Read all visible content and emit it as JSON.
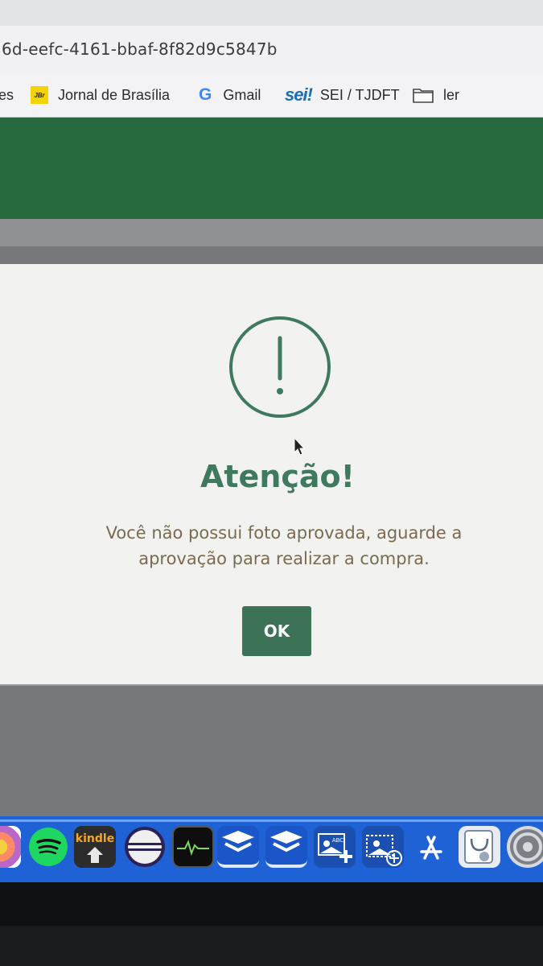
{
  "browser": {
    "url": "6d-eefc-4161-bbaf-8f82d9c5847b",
    "bookmarks": [
      {
        "label": "es",
        "icon": "truncated"
      },
      {
        "label": "Jornal de Brasília",
        "icon": "jbr-icon",
        "icon_text": "JBr"
      },
      {
        "label": "Gmail",
        "icon": "google-icon",
        "icon_text": "G"
      },
      {
        "label": "SEI / TJDFT",
        "icon": "sei-icon",
        "icon_text": "sei!"
      },
      {
        "label": "ler",
        "icon": "folder-icon"
      }
    ]
  },
  "dialog": {
    "icon": "exclamation-circle-icon",
    "icon_symbol": "!",
    "title": "Atenção!",
    "message_line1": "Você não possui foto aprovada, aguarde a",
    "message_line2": "aprovação para realizar a compra.",
    "ok_label": "OK"
  },
  "dock": {
    "items": [
      {
        "name": "photos-icon"
      },
      {
        "name": "spotify-icon"
      },
      {
        "name": "kindle-icon",
        "label": "kindle"
      },
      {
        "name": "eclipse-icon"
      },
      {
        "name": "activity-monitor-icon"
      },
      {
        "name": "receita-federal-icon-1"
      },
      {
        "name": "receita-federal-icon-2"
      },
      {
        "name": "image-capture-icon-1",
        "label": "ABC"
      },
      {
        "name": "image-capture-icon-2"
      },
      {
        "name": "app-store-icon"
      },
      {
        "name": "preview-icon"
      },
      {
        "name": "system-preferences-icon"
      }
    ]
  },
  "colors": {
    "header_green": "#266a3e",
    "dialog_accent": "#3f7a5e",
    "ok_button": "#3c7356",
    "dock_blue": "#1e62d6"
  }
}
